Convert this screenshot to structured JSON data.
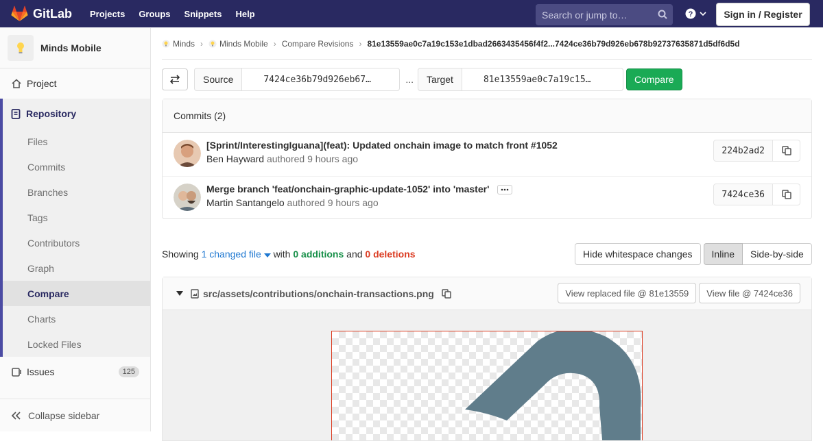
{
  "topbar": {
    "brand": "GitLab",
    "nav": [
      "Projects",
      "Groups",
      "Snippets",
      "Help"
    ],
    "search_placeholder": "Search or jump to…",
    "signin_label": "Sign in / Register"
  },
  "sidebar": {
    "project_name": "Minds Mobile",
    "project_label": "Project",
    "repository_label": "Repository",
    "repo_items": [
      "Files",
      "Commits",
      "Branches",
      "Tags",
      "Contributors",
      "Graph",
      "Compare",
      "Charts",
      "Locked Files"
    ],
    "active_item": "Compare",
    "issues_label": "Issues",
    "issues_count": "125",
    "collapse_label": "Collapse sidebar"
  },
  "breadcrumb": {
    "group": "Minds",
    "project": "Minds Mobile",
    "section": "Compare Revisions",
    "current": "81e13559ae0c7a19c153e1dbad2663435456f4f2...7424ce36b79d926eb678b92737635871d5df6d5d"
  },
  "compare": {
    "source_label": "Source",
    "source_ref": "7424ce36b79d926eb67…",
    "separator": "...",
    "target_label": "Target",
    "target_ref": "81e13559ae0c7a19c15…",
    "button": "Compare"
  },
  "commits": {
    "header": "Commits (2)",
    "items": [
      {
        "title": "[Sprint/InterestingIguana](feat): Updated onchain image to match front #1052",
        "author": "Ben Hayward",
        "meta": "authored 9 hours ago",
        "sha": "224b2ad2"
      },
      {
        "title": "Merge branch 'feat/onchain-graphic-update-1052' into 'master'",
        "author": "Martin Santangelo",
        "meta": "authored 9 hours ago",
        "sha": "7424ce36"
      }
    ]
  },
  "summary": {
    "prefix": "Showing",
    "changed": "1 changed file",
    "with": "with",
    "additions": "0 additions",
    "and": "and",
    "deletions": "0 deletions"
  },
  "view_buttons": {
    "whitespace": "Hide whitespace changes",
    "inline": "Inline",
    "side_by_side": "Side-by-side"
  },
  "file": {
    "path": "src/assets/contributions/onchain-transactions.png",
    "view_replaced": "View replaced file @ 81e13559",
    "view_file": "View file @ 7424ce36"
  },
  "colors": {
    "topbar": "#292961",
    "compare_button": "#1aaa55",
    "link": "#1f78d1",
    "additions": "#168f48",
    "deletions": "#db3b21",
    "image_shape": "#607d8b"
  }
}
